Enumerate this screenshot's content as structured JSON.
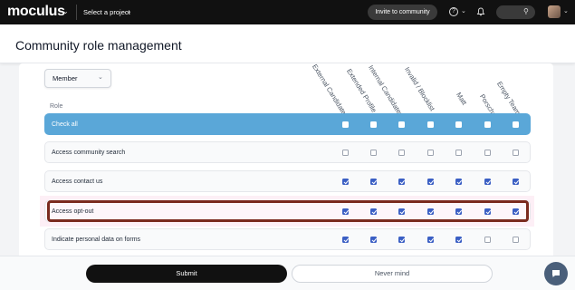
{
  "topbar": {
    "logo": "moculus",
    "project_select": "Select a project",
    "invite_button": "Invite to community",
    "help_icon": "?",
    "icons": [
      "chevron-down-icon",
      "help-icon",
      "bell-icon",
      "search-icon",
      "avatar"
    ]
  },
  "header": {
    "title": "Community role management"
  },
  "filter": {
    "selected": "Member"
  },
  "table": {
    "role_header": "Role",
    "columns": [
      "External Candidates",
      "Extended Profile",
      "Internal Candidates",
      "Invalid / Blocklist",
      "Matt",
      "Porscha",
      "Empty Team"
    ],
    "rows": [
      {
        "label": "Check all",
        "checks": [
          false,
          false,
          false,
          false,
          false,
          false,
          false
        ]
      },
      {
        "label": "Access community search",
        "checks": [
          false,
          false,
          false,
          false,
          false,
          false,
          false
        ]
      },
      {
        "label": "Access contact us",
        "checks": [
          true,
          true,
          true,
          true,
          true,
          true,
          true
        ]
      },
      {
        "label": "Access opt-out",
        "checks": [
          true,
          true,
          true,
          true,
          true,
          true,
          true
        ]
      },
      {
        "label": "Indicate personal data on forms",
        "checks": [
          true,
          true,
          true,
          true,
          true,
          false,
          false
        ]
      }
    ]
  },
  "footer": {
    "submit": "Submit",
    "cancel": "Never mind"
  },
  "colors": {
    "topbar": "#111111",
    "checkall_row": "#5aa7d8",
    "checkbox_on": "#3b5fc4",
    "highlight_border": "#7a2a1e"
  }
}
